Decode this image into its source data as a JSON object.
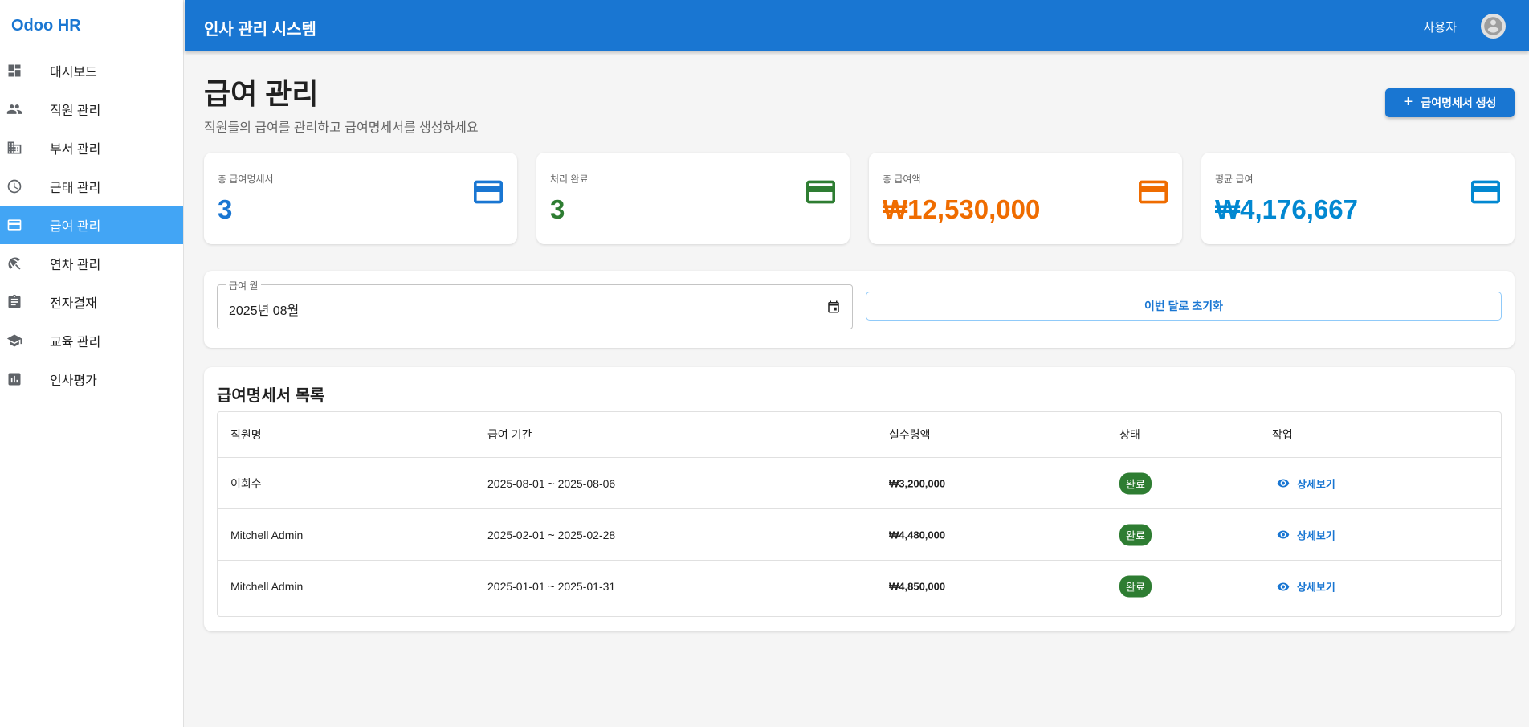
{
  "brand": "Odoo HR",
  "sidebar": {
    "items": [
      {
        "label": "대시보드",
        "icon": "dashboard-icon"
      },
      {
        "label": "직원 관리",
        "icon": "people-icon"
      },
      {
        "label": "부서 관리",
        "icon": "building-icon"
      },
      {
        "label": "근태 관리",
        "icon": "clock-icon"
      },
      {
        "label": "급여 관리",
        "icon": "credit-card-icon",
        "active": true
      },
      {
        "label": "연차 관리",
        "icon": "beach-umbrella-icon"
      },
      {
        "label": "전자결재",
        "icon": "clipboard-icon"
      },
      {
        "label": "교육 관리",
        "icon": "graduation-cap-icon"
      },
      {
        "label": "인사평가",
        "icon": "bar-chart-icon"
      }
    ]
  },
  "header": {
    "title": "인사 관리 시스템",
    "user_label": "사용자"
  },
  "page": {
    "title": "급여 관리",
    "subtitle": "직원들의 급여를 관리하고 급여명세서를 생성하세요",
    "create_button": "급여명세서 생성"
  },
  "stats": [
    {
      "label": "총 급여명세서",
      "value": "3",
      "color": "#1976d2"
    },
    {
      "label": "처리 완료",
      "value": "3",
      "color": "#2e7d32"
    },
    {
      "label": "총 급여액",
      "value": "₩12,530,000",
      "color": "#ef6c00"
    },
    {
      "label": "평균 급여",
      "value": "₩4,176,667",
      "color": "#0288d1"
    }
  ],
  "filter": {
    "month_legend": "급여 월",
    "month_value": "2025년 08월",
    "reset_button": "이번 달로 초기화"
  },
  "payslips": {
    "title": "급여명세서 목록",
    "columns": [
      "직원명",
      "급여 기간",
      "실수령액",
      "상태",
      "작업"
    ],
    "rows": [
      {
        "name": "이회수",
        "period": "2025-08-01 ~ 2025-08-06",
        "amount": "₩3,200,000",
        "status": "완료",
        "action": "상세보기"
      },
      {
        "name": "Mitchell Admin",
        "period": "2025-02-01 ~ 2025-02-28",
        "amount": "₩4,480,000",
        "status": "완료",
        "action": "상세보기"
      },
      {
        "name": "Mitchell Admin",
        "period": "2025-01-01 ~ 2025-01-31",
        "amount": "₩4,850,000",
        "status": "완료",
        "action": "상세보기"
      }
    ]
  },
  "colors": {
    "primary": "#1976d2",
    "sidebar_active": "#42a5f5",
    "status_complete": "#2e7d32"
  }
}
